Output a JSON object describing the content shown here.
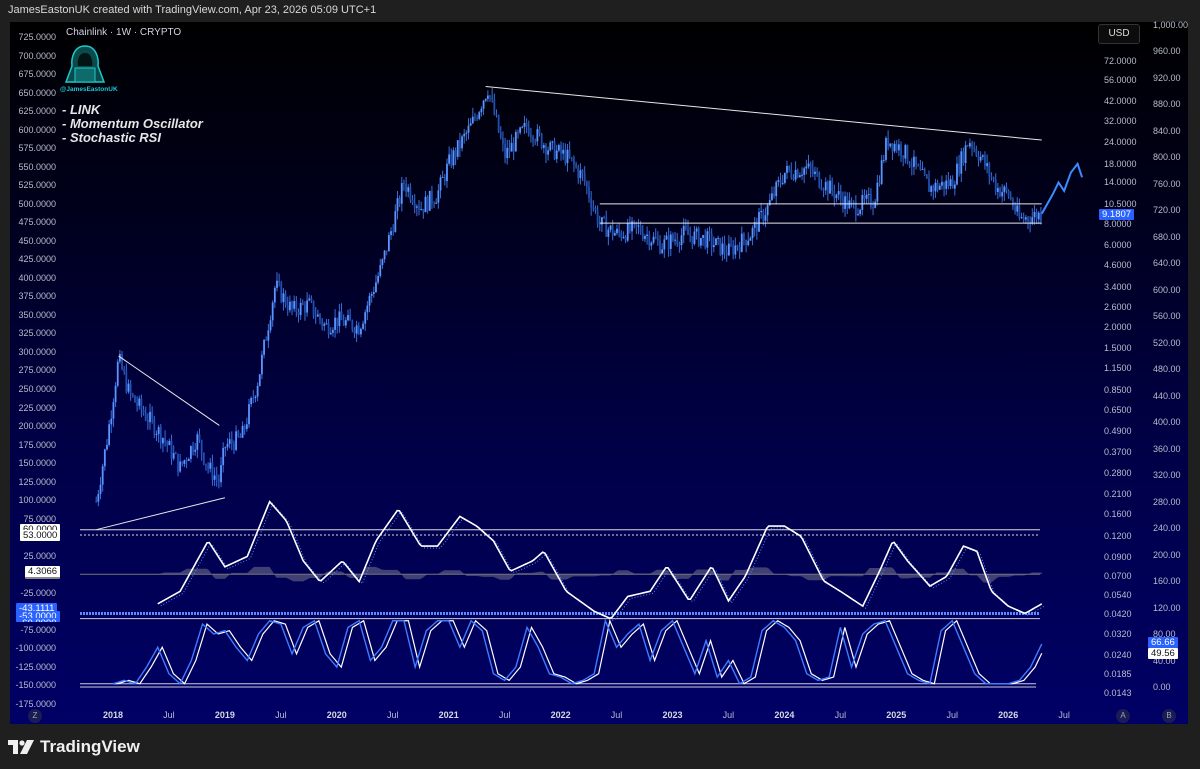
{
  "header": "JamesEastonUK created with TradingView.com, Apr 23, 2026 05:09 UTC+1",
  "symbol_title": "Chainlink · 1W · CRYPTO",
  "logo_handle": "@JamesEastonUK",
  "notes": [
    "- LINK",
    "- Momentum Oscillator",
    "- Stochastic RSI"
  ],
  "currency": "USD",
  "scale_buttons": {
    "z": "Z",
    "a": "A",
    "b": "B"
  },
  "footer_brand": "TradingView",
  "colors": {
    "price": "#4a86f0",
    "accent": "#2962ff",
    "line": "#ffffff"
  },
  "chart_data": {
    "type": "line",
    "title": "Chainlink · 1W · CRYPTO",
    "x_ticks": [
      {
        "label": "2018",
        "t": 2018,
        "bold": true
      },
      {
        "label": "Jul",
        "t": 2018.5
      },
      {
        "label": "2019",
        "t": 2019,
        "bold": true
      },
      {
        "label": "Jul",
        "t": 2019.5
      },
      {
        "label": "2020",
        "t": 2020,
        "bold": true
      },
      {
        "label": "Jul",
        "t": 2020.5
      },
      {
        "label": "2021",
        "t": 2021,
        "bold": true
      },
      {
        "label": "Jul",
        "t": 2021.5
      },
      {
        "label": "2022",
        "t": 2022,
        "bold": true
      },
      {
        "label": "Jul",
        "t": 2022.5
      },
      {
        "label": "2023",
        "t": 2023,
        "bold": true
      },
      {
        "label": "Jul",
        "t": 2023.5
      },
      {
        "label": "2024",
        "t": 2024,
        "bold": true
      },
      {
        "label": "Jul",
        "t": 2024.5
      },
      {
        "label": "2025",
        "t": 2025,
        "bold": true
      },
      {
        "label": "Jul",
        "t": 2025.5
      },
      {
        "label": "2026",
        "t": 2026,
        "bold": true
      },
      {
        "label": "Jul",
        "t": 2026.5
      }
    ],
    "left_axis_ticks": [
      "725.0000",
      "700.0000",
      "675.0000",
      "650.0000",
      "625.0000",
      "600.0000",
      "575.0000",
      "550.0000",
      "525.0000",
      "500.0000",
      "475.0000",
      "450.0000",
      "425.0000",
      "400.0000",
      "375.0000",
      "350.0000",
      "325.0000",
      "300.0000",
      "275.0000",
      "250.0000",
      "225.0000",
      "200.0000",
      "175.0000",
      "150.0000",
      "125.0000",
      "100.0000",
      "75.0000",
      "25.0000",
      "-25.0000",
      "-75.0000",
      "-100.0000",
      "-125.0000",
      "-150.0000",
      "-175.0000"
    ],
    "price_axis_ticks": [
      "72.0000",
      "56.0000",
      "42.0000",
      "32.0000",
      "24.0000",
      "18.0000",
      "14.0000",
      "10.5000",
      "8.0000",
      "6.0000",
      "4.6000",
      "3.4000",
      "2.6000",
      "2.0000",
      "1.5000",
      "1.1500",
      "0.8500",
      "0.6500",
      "0.4900",
      "0.3700",
      "0.2800",
      "0.2100",
      "0.1600",
      "0.1200",
      "0.0900",
      "0.0700",
      "0.0540",
      "0.0420",
      "0.0320",
      "0.0240",
      "0.0185",
      "0.0143"
    ],
    "right_axis_ticks": [
      "1,000.00",
      "960.00",
      "920.00",
      "880.00",
      "840.00",
      "800.00",
      "760.00",
      "720.00",
      "680.00",
      "640.00",
      "600.00",
      "560.00",
      "520.00",
      "480.00",
      "440.00",
      "400.00",
      "360.00",
      "320.00",
      "280.00",
      "240.00",
      "200.00",
      "160.00",
      "120.00",
      "80.00",
      "40.00",
      "0.00"
    ],
    "price_series": {
      "name": "LINK/USD",
      "scale": "log",
      "points": [
        [
          2017.85,
          0.19
        ],
        [
          2017.95,
          0.45
        ],
        [
          2018.05,
          1.3
        ],
        [
          2018.15,
          0.8
        ],
        [
          2018.3,
          0.6
        ],
        [
          2018.45,
          0.45
        ],
        [
          2018.6,
          0.3
        ],
        [
          2018.75,
          0.45
        ],
        [
          2018.85,
          0.3
        ],
        [
          2018.95,
          0.25
        ],
        [
          2019.0,
          0.4
        ],
        [
          2019.15,
          0.45
        ],
        [
          2019.3,
          1.0
        ],
        [
          2019.45,
          3.5
        ],
        [
          2019.6,
          2.5
        ],
        [
          2019.75,
          2.7
        ],
        [
          2019.9,
          2.0
        ],
        [
          2020.0,
          2.2
        ],
        [
          2020.2,
          2.0
        ],
        [
          2020.4,
          4.5
        ],
        [
          2020.6,
          14
        ],
        [
          2020.75,
          10
        ],
        [
          2020.9,
          12
        ],
        [
          2021.0,
          18
        ],
        [
          2021.2,
          30
        ],
        [
          2021.35,
          50
        ],
        [
          2021.5,
          20
        ],
        [
          2021.7,
          30
        ],
        [
          2021.9,
          22
        ],
        [
          2022.05,
          20
        ],
        [
          2022.2,
          15
        ],
        [
          2022.35,
          8
        ],
        [
          2022.5,
          7
        ],
        [
          2022.7,
          7.5
        ],
        [
          2022.9,
          6
        ],
        [
          2023.1,
          7
        ],
        [
          2023.3,
          6.5
        ],
        [
          2023.5,
          5.5
        ],
        [
          2023.7,
          7
        ],
        [
          2023.85,
          10
        ],
        [
          2024.0,
          16
        ],
        [
          2024.2,
          17
        ],
        [
          2024.4,
          13
        ],
        [
          2024.6,
          10
        ],
        [
          2024.8,
          11
        ],
        [
          2024.92,
          25
        ],
        [
          2025.05,
          22
        ],
        [
          2025.3,
          13
        ],
        [
          2025.5,
          14
        ],
        [
          2025.65,
          25
        ],
        [
          2025.75,
          20
        ],
        [
          2025.9,
          13
        ],
        [
          2026.0,
          12
        ],
        [
          2026.1,
          8.5
        ],
        [
          2026.3,
          9.18
        ]
      ]
    },
    "projection": [
      [
        2026.3,
        9.18
      ],
      [
        2026.4,
        12
      ],
      [
        2026.45,
        14
      ],
      [
        2026.5,
        12.5
      ],
      [
        2026.56,
        16
      ],
      [
        2026.62,
        18
      ],
      [
        2026.66,
        15
      ]
    ],
    "trendlines": [
      {
        "name": "descending-resistance",
        "from": [
          2021.33,
          51
        ],
        "to": [
          2026.3,
          24.8
        ]
      },
      {
        "name": "range-top",
        "from": [
          2022.35,
          10.5
        ],
        "to": [
          2026.3,
          10.5
        ]
      },
      {
        "name": "range-bottom",
        "from": [
          2022.35,
          8.1
        ],
        "to": [
          2026.3,
          8.1
        ]
      },
      {
        "name": "triangle-top",
        "from": [
          2018.05,
          1.35
        ],
        "to": [
          2018.95,
          0.53
        ]
      },
      {
        "name": "triangle-bottom",
        "from": [
          2017.85,
          0.13
        ],
        "to": [
          2019.0,
          0.2
        ]
      }
    ],
    "last_price": "9.1807",
    "momentum": {
      "name": "Momentum Oscillator",
      "levels": [
        60,
        53,
        0,
        -53,
        -60
      ],
      "points": [
        [
          2018.4,
          -40
        ],
        [
          2018.6,
          -23
        ],
        [
          2018.85,
          45
        ],
        [
          2019.0,
          10
        ],
        [
          2019.2,
          24
        ],
        [
          2019.4,
          98
        ],
        [
          2019.55,
          72
        ],
        [
          2019.7,
          18
        ],
        [
          2019.85,
          -10
        ],
        [
          2020.05,
          18
        ],
        [
          2020.2,
          -10
        ],
        [
          2020.35,
          45
        ],
        [
          2020.55,
          88
        ],
        [
          2020.75,
          38
        ],
        [
          2020.9,
          38
        ],
        [
          2021.1,
          78
        ],
        [
          2021.25,
          65
        ],
        [
          2021.4,
          45
        ],
        [
          2021.55,
          4
        ],
        [
          2021.75,
          18
        ],
        [
          2021.85,
          31
        ],
        [
          2022.05,
          -23
        ],
        [
          2022.3,
          -50
        ],
        [
          2022.45,
          -60
        ],
        [
          2022.6,
          -30
        ],
        [
          2022.8,
          -23
        ],
        [
          2022.95,
          11
        ],
        [
          2023.15,
          -36
        ],
        [
          2023.35,
          11
        ],
        [
          2023.5,
          -36
        ],
        [
          2023.65,
          -3
        ],
        [
          2023.85,
          65
        ],
        [
          2024.0,
          65
        ],
        [
          2024.15,
          51
        ],
        [
          2024.35,
          -9
        ],
        [
          2024.5,
          -23
        ],
        [
          2024.7,
          -43
        ],
        [
          2024.85,
          4
        ],
        [
          2024.97,
          45
        ],
        [
          2025.1,
          18
        ],
        [
          2025.3,
          -16
        ],
        [
          2025.45,
          -3
        ],
        [
          2025.6,
          38
        ],
        [
          2025.72,
          31
        ],
        [
          2025.85,
          -23
        ],
        [
          2026.0,
          -43
        ],
        [
          2026.15,
          -53
        ],
        [
          2026.3,
          -40
        ]
      ],
      "badges": {
        "upper": "60.0000",
        "upper2": "53.0000",
        "value": "4.3066",
        "lower1": "-43.1111",
        "lower2": "-53.0000",
        "lower3": "-60.0000"
      }
    },
    "stoch_rsi": {
      "name": "Stochastic RSI",
      "start": 2018.0,
      "step": 0.1,
      "levels": [
        5,
        0
      ],
      "k": [
        5,
        10,
        5,
        30,
        60,
        20,
        5,
        40,
        95,
        80,
        85,
        60,
        40,
        80,
        100,
        95,
        50,
        90,
        100,
        50,
        30,
        90,
        100,
        40,
        60,
        100,
        100,
        30,
        85,
        100,
        100,
        60,
        100,
        85,
        20,
        10,
        30,
        90,
        60,
        20,
        15,
        5,
        10,
        20,
        100,
        60,
        80,
        95,
        40,
        85,
        100,
        60,
        20,
        70,
        15,
        40,
        5,
        15,
        85,
        100,
        90,
        70,
        20,
        10,
        15,
        90,
        30,
        80,
        95,
        100,
        60,
        20,
        10,
        5,
        85,
        100,
        60,
        20,
        5,
        5,
        5,
        10,
        30,
        65
      ],
      "k_value": "66.66",
      "d_value": "49.56"
    }
  }
}
